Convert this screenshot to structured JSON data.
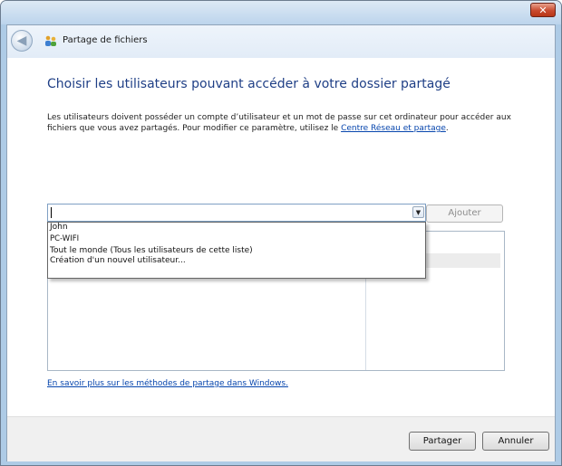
{
  "window": {
    "title": "Partage de fichiers",
    "close_glyph": "✕"
  },
  "nav": {
    "back_glyph": "◀",
    "app_icon": "users-share-icon"
  },
  "main": {
    "heading": "Choisir les utilisateurs pouvant accéder à votre dossier partagé",
    "desc_text": "Les utilisateurs doivent posséder un compte d’utilisateur et un mot de passe sur cet ordinateur pour accéder aux fichiers que vous avez partagés. Pour modifier ce paramètre, utilisez le ",
    "desc_link": "Centre Réseau et partage",
    "desc_end": ".",
    "combo_value": "",
    "combo_arrow": "▼",
    "add_label": "Ajouter",
    "column_header": "utorisation",
    "perm_value": "e ▼",
    "dropdown_items": [
      "John",
      "PC-WIFI",
      "Tout le monde (Tous les utilisateurs de cette liste)",
      "Création d'un nouvel utilisateur..."
    ],
    "learn_link": "En savoir plus sur les méthodes de partage dans Windows."
  },
  "footer": {
    "share_label": "Partager",
    "cancel_label": "Annuler"
  },
  "colors": {
    "heading": "#1f3f86",
    "link": "#0645ad",
    "close_red": "#c84a2f"
  }
}
